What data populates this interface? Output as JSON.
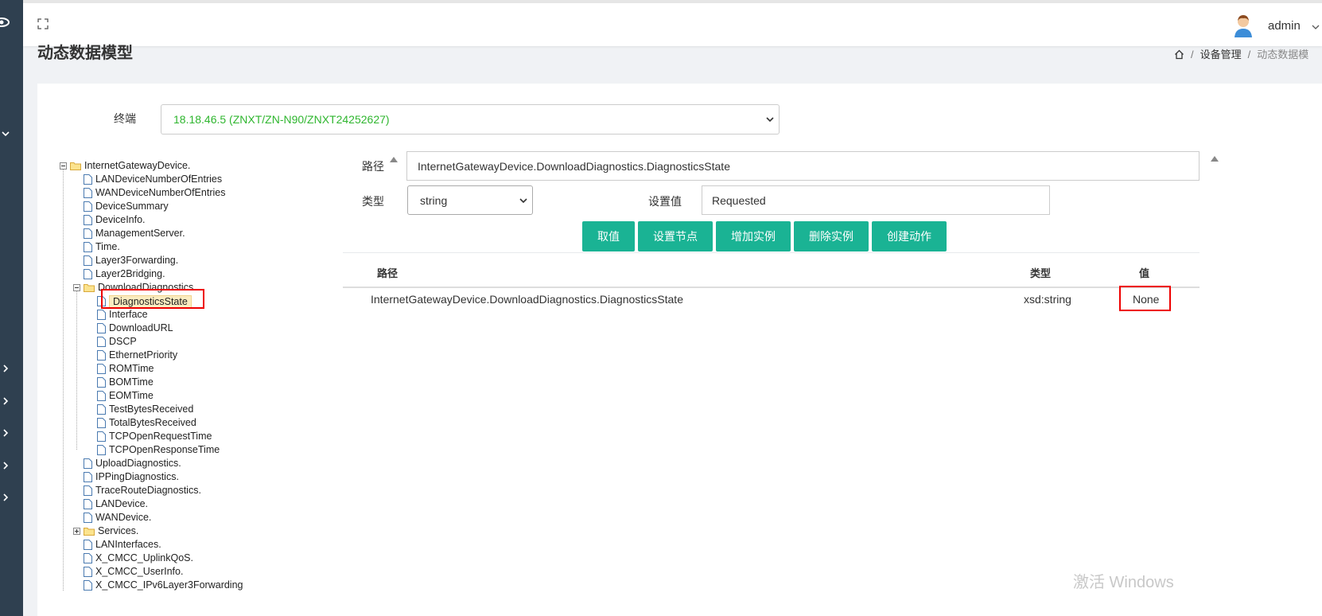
{
  "header": {
    "username": "admin"
  },
  "page": {
    "title": "动态数据模型",
    "breadcrumb": {
      "section": "设备管理",
      "current": "动态数据模"
    }
  },
  "terminal": {
    "label": "终端",
    "selected": "18.18.46.5 (ZNXT/ZN-N90/ZNXT24252627)"
  },
  "tree": {
    "root": "InternetGatewayDevice.",
    "items": [
      "LANDeviceNumberOfEntries",
      "WANDeviceNumberOfEntries",
      "DeviceSummary",
      "DeviceInfo.",
      "ManagementServer.",
      "Time.",
      "Layer3Forwarding.",
      "Layer2Bridging.",
      "DownloadDiagnostics.",
      "UploadDiagnostics.",
      "IPPingDiagnostics.",
      "TraceRouteDiagnostics.",
      "LANDevice.",
      "WANDevice.",
      "Services.",
      "LANInterfaces.",
      "X_CMCC_UplinkQoS.",
      "X_CMCC_UserInfo.",
      "X_CMCC_IPv6Layer3Forwarding"
    ],
    "children": [
      "DiagnosticsState",
      "Interface",
      "DownloadURL",
      "DSCP",
      "EthernetPriority",
      "ROMTime",
      "BOMTime",
      "EOMTime",
      "TestBytesReceived",
      "TotalBytesReceived",
      "TCPOpenRequestTime",
      "TCPOpenResponseTime"
    ]
  },
  "form": {
    "path_label": "路径",
    "path_value": "InternetGatewayDevice.DownloadDiagnostics.DiagnosticsState",
    "type_label": "类型",
    "type_value": "string",
    "set_value_label": "设置值",
    "set_value": "Requested"
  },
  "buttons": {
    "get_value": "取值",
    "set_node": "设置节点",
    "add_instance": "增加实例",
    "delete_instance": "删除实例",
    "create_action": "创建动作"
  },
  "result_table": {
    "headers": [
      "路径",
      "类型",
      "值"
    ],
    "rows": [
      [
        "InternetGatewayDevice.DownloadDiagnostics.DiagnosticsState",
        "xsd:string",
        "None"
      ]
    ]
  },
  "watermark": "激活 Windows",
  "colors": {
    "accent": "#1ab394",
    "sidebar": "#2f4050",
    "terminal_text": "#2fb62f",
    "highlight_box": "#e00000"
  }
}
